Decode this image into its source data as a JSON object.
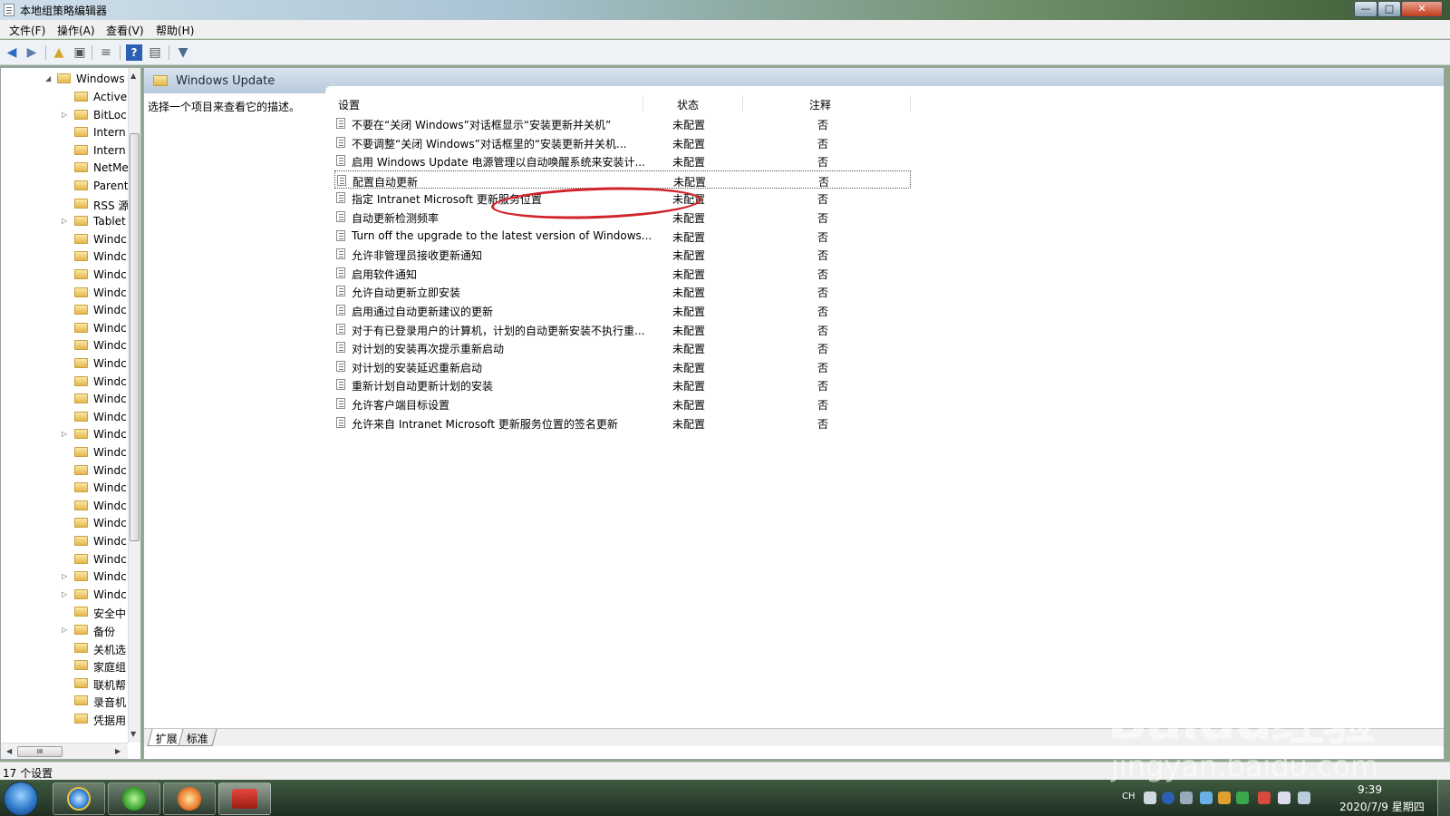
{
  "window": {
    "title": "本地组策略编辑器",
    "min": "—",
    "max": "□",
    "close": "✕"
  },
  "menu": [
    "文件(F)",
    "操作(A)",
    "查看(V)",
    "帮助(H)"
  ],
  "tree": {
    "root": "Windows",
    "items": [
      "Active",
      "BitLoc",
      "Intern",
      "Intern",
      "NetMe",
      "Parent",
      "RSS 源",
      "Tablet",
      "Windc",
      "Windc",
      "Windc",
      "Windc",
      "Windc",
      "Windc",
      "Windc",
      "Windc",
      "Windc",
      "Windc",
      "Windc",
      "Windc",
      "Windc",
      "Windc",
      "Windc",
      "Windc",
      "Windc",
      "Windc",
      "Windc",
      "Windc",
      "Windc",
      "安全中",
      "备份",
      "关机选",
      "家庭组",
      "联机帮",
      "录音机",
      "凭据用"
    ],
    "hscroll_grip": "III"
  },
  "pane": {
    "title": "Windows Update",
    "description": "选择一个项目来查看它的描述。",
    "columns": {
      "setting": "设置",
      "state": "状态",
      "note": "注释"
    },
    "rows": [
      {
        "name": "不要在“关闭 Windows”对话框显示“安装更新并关机”",
        "state": "未配置",
        "note": "否"
      },
      {
        "name": "不要调整“关闭 Windows”对话框里的“安装更新并关机...",
        "state": "未配置",
        "note": "否"
      },
      {
        "name": "启用 Windows Update 电源管理以自动唤醒系统来安装计...",
        "state": "未配置",
        "note": "否"
      },
      {
        "name": "配置自动更新",
        "state": "未配置",
        "note": "否"
      },
      {
        "name": "指定 Intranet Microsoft 更新服务位置",
        "state": "未配置",
        "note": "否"
      },
      {
        "name": "自动更新检测频率",
        "state": "未配置",
        "note": "否"
      },
      {
        "name": "Turn off the upgrade to the latest version of Windows...",
        "state": "未配置",
        "note": "否"
      },
      {
        "name": "允许非管理员接收更新通知",
        "state": "未配置",
        "note": "否"
      },
      {
        "name": "启用软件通知",
        "state": "未配置",
        "note": "否"
      },
      {
        "name": "允许自动更新立即安装",
        "state": "未配置",
        "note": "否"
      },
      {
        "name": "启用通过自动更新建议的更新",
        "state": "未配置",
        "note": "否"
      },
      {
        "name": "对于有已登录用户的计算机，计划的自动更新安装不执行重...",
        "state": "未配置",
        "note": "否"
      },
      {
        "name": "对计划的安装再次提示重新启动",
        "state": "未配置",
        "note": "否"
      },
      {
        "name": "对计划的安装延迟重新启动",
        "state": "未配置",
        "note": "否"
      },
      {
        "name": "重新计划自动更新计划的安装",
        "state": "未配置",
        "note": "否"
      },
      {
        "name": "允许客户端目标设置",
        "state": "未配置",
        "note": "否"
      },
      {
        "name": "允许来自 Intranet Microsoft 更新服务位置的签名更新",
        "state": "未配置",
        "note": "否"
      }
    ],
    "focused_row": "配置自动更新",
    "tabs": [
      "扩展",
      "标准"
    ]
  },
  "status": "17 个设置",
  "taskbar": {
    "lang": "CH",
    "time": "9:39",
    "date": "2020/7/9 星期四"
  },
  "watermark": {
    "logo": "Baidu经验",
    "url": "jingyan.baidu.com"
  },
  "colors": {
    "highlight": "#d1232a",
    "header": "#b8c9db"
  }
}
